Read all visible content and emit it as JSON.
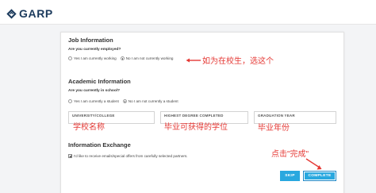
{
  "header": {
    "logo_text": "GARP"
  },
  "job_information": {
    "title": "Job Information",
    "question": "Are you currently employed?",
    "options": [
      "Yes I am currently working",
      "No I am not currently working"
    ],
    "selected_index": 1,
    "annotation": "如为在校生，选这个"
  },
  "academic_information": {
    "title": "Academic Information",
    "question": "Are you currently in school?",
    "options": [
      "Yes I am currently a student",
      "No I am not currently a student"
    ],
    "selected_index": 1,
    "fields": [
      {
        "label": "UNIVERSITY/COLLEGE",
        "annotation": "学校名称"
      },
      {
        "label": "HIGHEST DEGREE COMPLETED",
        "annotation": "毕业可获得的学位"
      },
      {
        "label": "GRADUATION YEAR",
        "annotation": "毕业年份"
      }
    ]
  },
  "information_exchange": {
    "title": "Information Exchange",
    "checkbox_label": "I'd like to receive emails/special offers from carefully selected partners.",
    "checked": true
  },
  "buttons": {
    "skip": "SKIP",
    "complete": "COMPLETE",
    "complete_annotation": "点击\"完成\""
  },
  "colors": {
    "annotation": "#e53935",
    "button": "#29a8df",
    "logo": "#1b3a5c"
  }
}
